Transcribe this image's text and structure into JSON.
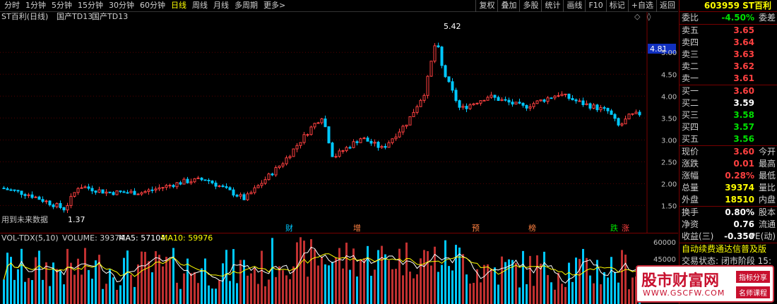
{
  "toolbar": {
    "periods": [
      "分时",
      "1分钟",
      "5分钟",
      "15分钟",
      "30分钟",
      "60分钟",
      "日线",
      "周线",
      "月线",
      "多周期",
      "更多>"
    ],
    "active_period": "日线",
    "tools": [
      "复权",
      "叠加",
      "多股",
      "统计",
      "画线",
      "F10",
      "标记",
      "+自选",
      "返回"
    ]
  },
  "chart": {
    "title": "ST百利(日线)",
    "indicator1": "国产TD13",
    "indicator2": "国产TD13",
    "high_label": "5.42",
    "low_label": "1.37",
    "current_price_tag": "4.81",
    "future_data_text": "用到未来数据",
    "event_markers": [
      "财",
      "增",
      "预",
      "榜",
      "跌",
      "涨"
    ],
    "price_axis": [
      "5.00",
      "4.50",
      "4.00",
      "3.50",
      "3.00",
      "2.50",
      "2.00",
      "1.50"
    ],
    "volume_header": {
      "name": "VOL-TDX(5,10)",
      "volume": "VOLUME: 39374",
      "ma5": "MA5: 57104",
      "ma10": "MA10: 59976"
    },
    "volume_axis": [
      "60000",
      "45000"
    ],
    "colors": {
      "up": "#ff4040",
      "down": "#00c8ff",
      "ma5": "#ffffff",
      "ma10": "#ffff00",
      "background": "#000000"
    }
  },
  "chart_data": {
    "type": "candlestick",
    "title": "ST百利(日线)",
    "ylim": [
      1.2,
      5.6
    ],
    "high": 5.42,
    "low": 1.37,
    "last_close": 3.6
  },
  "panel": {
    "code": "603959",
    "name": "ST百利",
    "weibi_label": "委比",
    "weibi_value": "-4.50%",
    "weicha_label": "委差",
    "asks": [
      {
        "label": "卖五",
        "price": "3.65"
      },
      {
        "label": "卖四",
        "price": "3.64"
      },
      {
        "label": "卖三",
        "price": "3.63"
      },
      {
        "label": "卖二",
        "price": "3.62"
      },
      {
        "label": "卖一",
        "price": "3.61"
      }
    ],
    "bids": [
      {
        "label": "买一",
        "price": "3.60"
      },
      {
        "label": "买二",
        "price": "3.59"
      },
      {
        "label": "买三",
        "price": "3.58"
      },
      {
        "label": "买四",
        "price": "3.57"
      },
      {
        "label": "买五",
        "price": "3.56"
      }
    ],
    "stats": [
      {
        "label": "现价",
        "value": "3.60",
        "label2": "今开",
        "color": "red"
      },
      {
        "label": "涨跌",
        "value": "0.01",
        "label2": "最高",
        "color": "red"
      },
      {
        "label": "涨幅",
        "value": "0.28%",
        "label2": "最低",
        "color": "red"
      },
      {
        "label": "总量",
        "value": "39374",
        "label2": "量比",
        "color": "yellow"
      },
      {
        "label": "外盘",
        "value": "18510",
        "label2": "内盘",
        "color": "yellow"
      }
    ],
    "stats2": [
      {
        "label": "换手",
        "value": "0.80%",
        "label2": "股本",
        "color": "white"
      },
      {
        "label": "净资",
        "value": "0.76",
        "label2": "流通",
        "color": "white"
      },
      {
        "label": "收益(三)",
        "value": "-0.350",
        "label2": "PE(动)",
        "color": "white"
      }
    ],
    "scroll_notice": "自动续费通达信普及版",
    "trade_status": "交易状态: 闭市阶段 15:"
  },
  "watermark": {
    "name": "股市财富网",
    "url": "WWW.GSCFW.COM",
    "tag1": "指标分享",
    "tag2": "名师课程"
  }
}
